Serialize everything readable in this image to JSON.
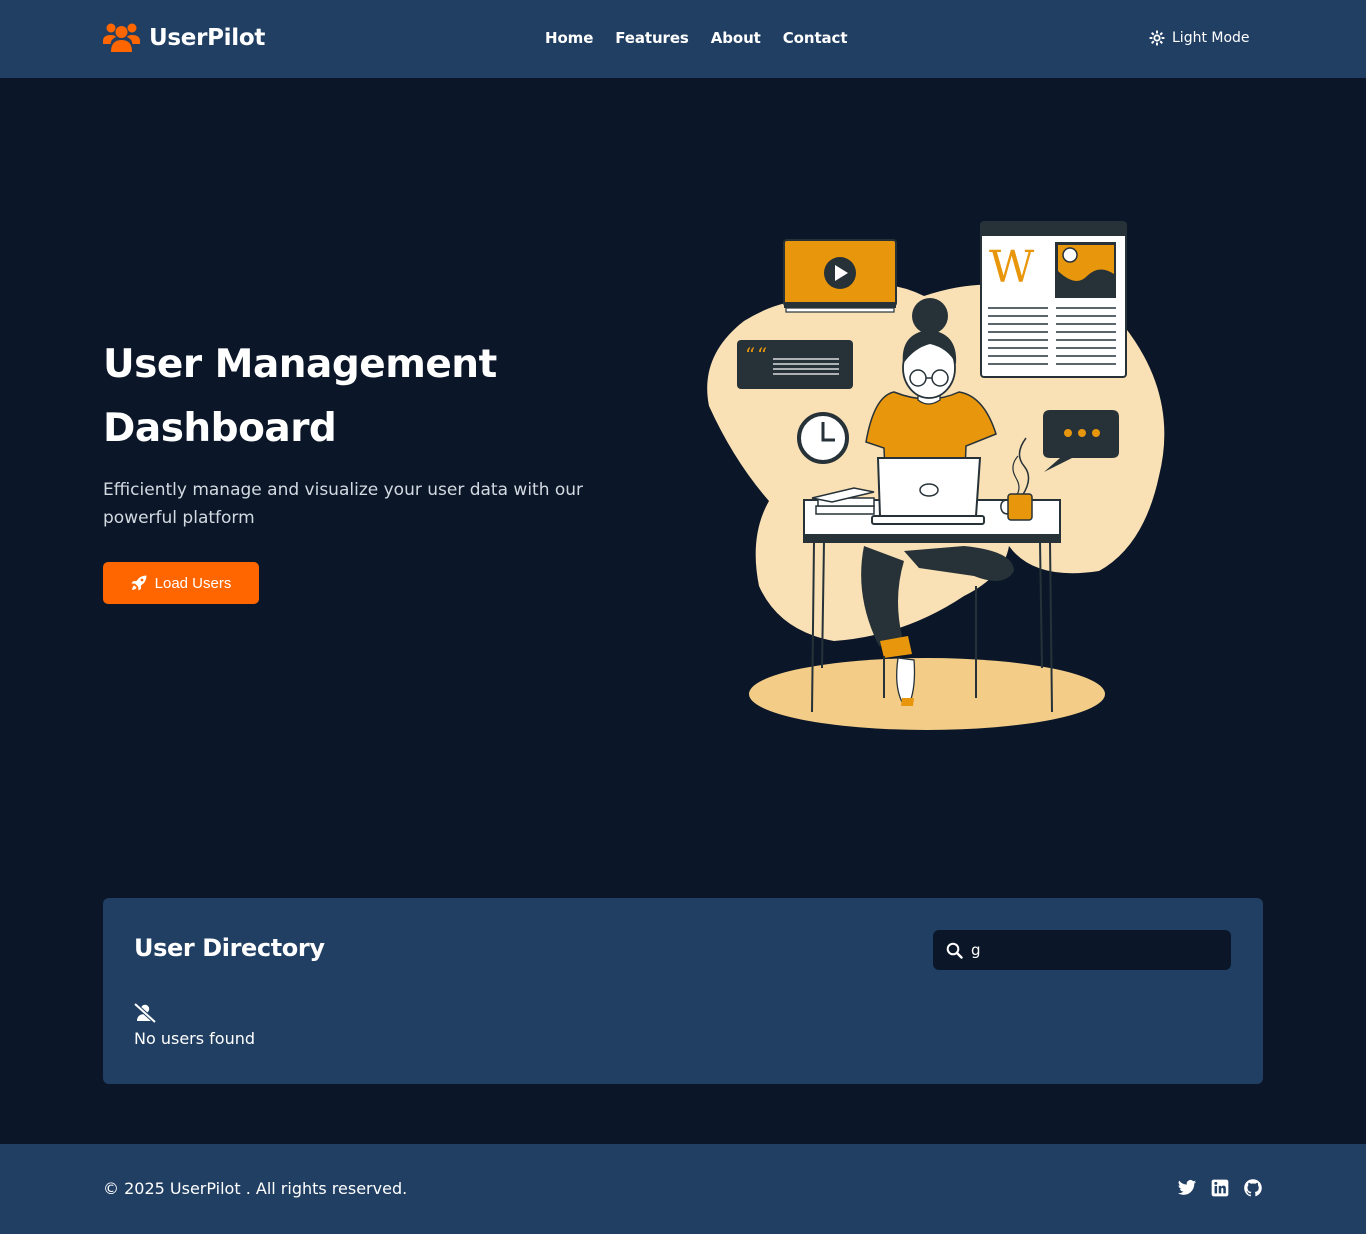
{
  "header": {
    "brand": "UserPilot",
    "logo_icon": "users-icon",
    "nav": [
      "Home",
      "Features",
      "About",
      "Contact"
    ],
    "theme_toggle_label": "Light Mode",
    "theme_icon": "sun-icon"
  },
  "hero": {
    "title": "User Management Dashboard",
    "subtitle": "Efficiently manage and visualize your user data with our powerful platform",
    "cta_label": "Load Users",
    "cta_icon": "rocket-icon",
    "illustration": "woman-working-on-laptop-illustration"
  },
  "directory": {
    "title": "User Directory",
    "search_value": "g",
    "search_icon": "search-icon",
    "empty_icon": "user-slash-icon",
    "empty_text": "No users found"
  },
  "footer": {
    "copyright": "© 2025 UserPilot . All rights reserved.",
    "socials": [
      "twitter-icon",
      "linkedin-icon",
      "github-icon"
    ]
  },
  "colors": {
    "header_bg": "#213f63",
    "page_bg": "#0b1729",
    "accent": "#ff6600",
    "illustration_orange": "#e8960c",
    "illustration_cream": "#f9e0b5"
  }
}
